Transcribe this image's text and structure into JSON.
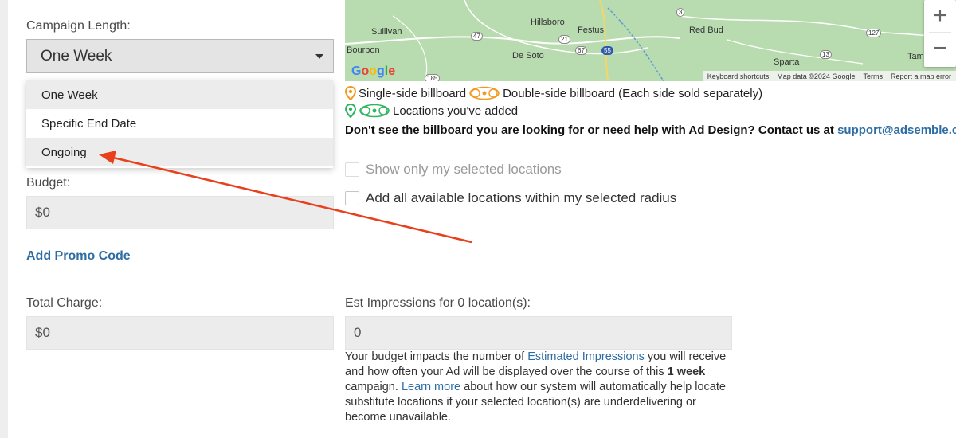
{
  "campaign": {
    "label": "Campaign Length:",
    "selected": "One Week",
    "options": [
      "One Week",
      "Specific End Date",
      "Ongoing"
    ]
  },
  "budget": {
    "label": "Budget:",
    "value": "$0"
  },
  "promo": {
    "label": "Add Promo Code"
  },
  "total": {
    "label": "Total Charge:",
    "value": "$0"
  },
  "impressions": {
    "label": "Est Impressions for 0 location(s):",
    "value": "0"
  },
  "map": {
    "towns": [
      "Sullivan",
      "Hillsboro",
      "Festus",
      "Red Bud",
      "Bourbon",
      "De Soto",
      "Sparta",
      "Tam"
    ],
    "shields": [
      "3",
      "47",
      "21",
      "67",
      "55",
      "13",
      "127",
      "185"
    ],
    "attribution": {
      "shortcuts": "Keyboard shortcuts",
      "data": "Map data ©2024 Google",
      "terms": "Terms",
      "report": "Report a map error"
    },
    "logo": "Google",
    "zoom_in": "+",
    "zoom_out": "−"
  },
  "legend": {
    "single": "Single-side billboard",
    "double": "Double-side billboard (Each side sold separately)",
    "added": "Locations you've added"
  },
  "help": {
    "text": "Don't see the billboard you are looking for or need help with Ad Design? Contact us at",
    "email": "support@adsemble.com"
  },
  "options": {
    "show_selected": "Show only my selected locations",
    "add_all": "Add all available locations within my selected radius"
  },
  "note": {
    "p1": "Your budget impacts the number of",
    "link1": "Estimated Impressions",
    "p2": "you will receive and how often your Ad will be displayed over the course of this",
    "bold": "1 week",
    "p3": "campaign.",
    "link2": "Learn more",
    "p4": "about how our system will automatically help locate substitute locations if your selected location(s) are underdelivering or become unavailable."
  },
  "colors": {
    "link": "#2e6da4",
    "arrow": "#e8401c",
    "pin_orange": "#f29a1f",
    "pin_green": "#2fb561"
  }
}
